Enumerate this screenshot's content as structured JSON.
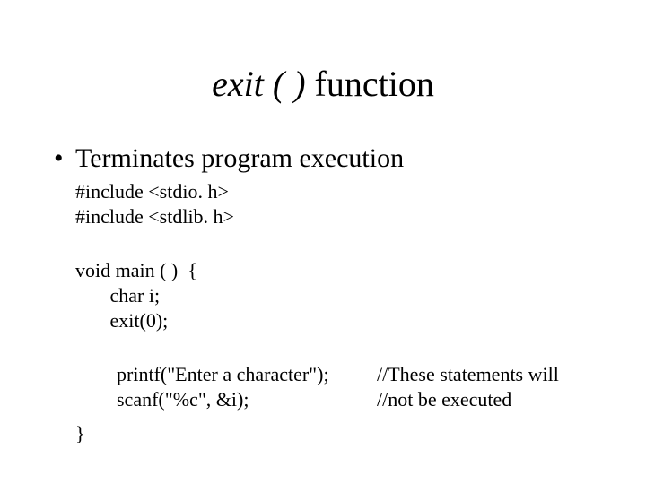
{
  "title": {
    "italic": "exit ( )",
    "rest": " function"
  },
  "bullet": {
    "marker": "•",
    "text": "Terminates program execution"
  },
  "code": {
    "includes": "#include <stdio. h>\n#include <stdlib. h>",
    "main": "void main ( )  {\n       char i;\n       exit(0);",
    "body1": "printf(\"Enter a character\");\nscanf(\"%c\", &i);",
    "comment": "//These statements will\n//not be executed",
    "closebr": "}"
  }
}
